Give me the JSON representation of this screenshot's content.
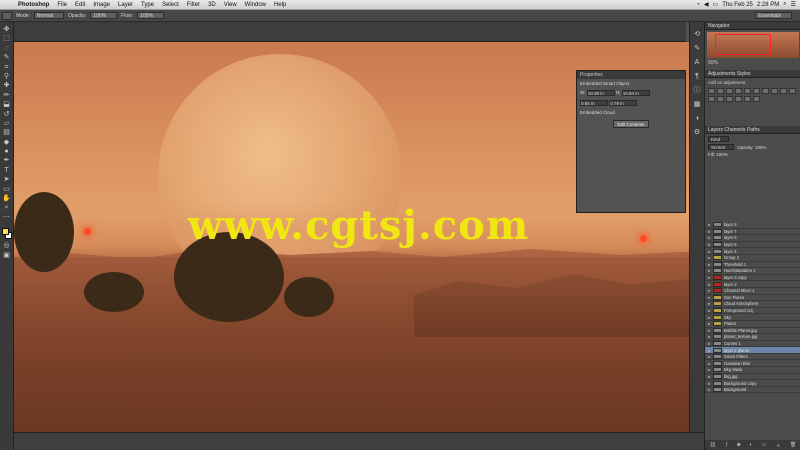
{
  "menubar": {
    "app": "Photoshop",
    "items": [
      "File",
      "Edit",
      "Image",
      "Layer",
      "Type",
      "Select",
      "Filter",
      "3D",
      "View",
      "Window",
      "Help"
    ],
    "clock": "Thu Feb 25",
    "time": "2:28 PM"
  },
  "options": {
    "mode_label": "Mode:",
    "mode_value": "Normal",
    "opacity_label": "Opacity:",
    "opacity_value": "100%",
    "flow_label": "Flow:",
    "flow_value": "100%",
    "workspace": "Essentials"
  },
  "canvas": {
    "watermark": "www.cgtsj.com"
  },
  "properties": {
    "title": "Properties",
    "subtitle": "Embedded Smart Object",
    "w_label": "W:",
    "w_value": "10.38 in",
    "h_label": "H:",
    "h_value": "10.84 in",
    "x_value": "0.65 in",
    "y_value": "0.79 in",
    "section": "Embedded Cloud",
    "button": "Edit Contents"
  },
  "right": {
    "navigator_tab": "Navigator",
    "zoom": "50%",
    "adjustments_tab": "Adjustments",
    "styles_tab": "Styles",
    "adjust_sub": "Add an adjustment",
    "layers_tab": "Layers",
    "channels_tab": "Channels",
    "paths_tab": "Paths",
    "kind": "Kind",
    "blend": "Screen",
    "opacity": "Opacity: 100%",
    "fill": "Fill: 100%",
    "layers": [
      {
        "name": "layer 8",
        "kind": "plain"
      },
      {
        "name": "layer 7",
        "kind": "plain"
      },
      {
        "name": "layer 6",
        "kind": "plain"
      },
      {
        "name": "layer 5",
        "kind": "plain"
      },
      {
        "name": "layer 4",
        "kind": "plain"
      },
      {
        "name": "Group 2",
        "kind": "grp"
      },
      {
        "name": "Threshold 1",
        "kind": "plain"
      },
      {
        "name": "Hue/Saturation 1",
        "kind": "plain"
      },
      {
        "name": "layer 3 copy",
        "kind": "red"
      },
      {
        "name": "layer 3",
        "kind": "red"
      },
      {
        "name": "Channel Mixer 1",
        "kind": "red"
      },
      {
        "name": "Sun Flares",
        "kind": "grp"
      },
      {
        "name": "Cloud Atmosphere",
        "kind": "grp"
      },
      {
        "name": "Foreground Adj",
        "kind": "grp"
      },
      {
        "name": "Sky",
        "kind": "grp"
      },
      {
        "name": "Planet",
        "kind": "grp"
      },
      {
        "name": "Bubble Planet.jpg",
        "kind": "plain"
      },
      {
        "name": "planet_texture.jpg",
        "kind": "plain"
      },
      {
        "name": "Curves 1",
        "kind": "plain"
      },
      {
        "name": "layer 2 planet",
        "kind": "sel"
      },
      {
        "name": "Smart Filters",
        "kind": "plain"
      },
      {
        "name": "Gaussian Blur",
        "kind": "plain"
      },
      {
        "name": "Bkg Mask",
        "kind": "plain"
      },
      {
        "name": "bkg.jpg",
        "kind": "plain"
      },
      {
        "name": "Background copy",
        "kind": "plain"
      },
      {
        "name": "Background",
        "kind": "plain"
      }
    ]
  }
}
